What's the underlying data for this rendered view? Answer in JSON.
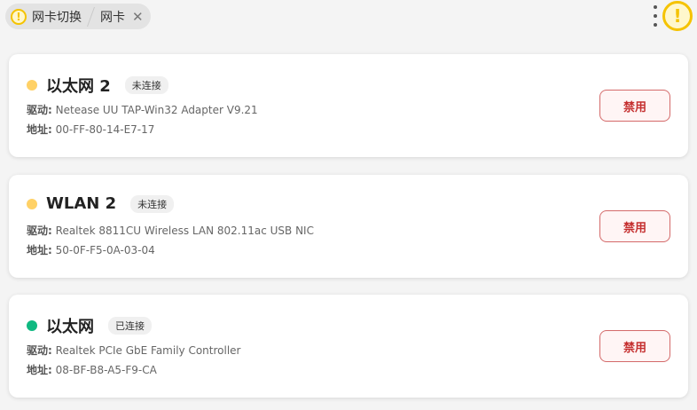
{
  "breadcrumb": {
    "items": [
      {
        "label": "网卡切换"
      },
      {
        "label": "网卡"
      }
    ],
    "close": "✕"
  },
  "header": {
    "warning_glyph": "!"
  },
  "labels": {
    "driver": "驱动:",
    "address": "地址:"
  },
  "colors": {
    "disconnected": "#ffd166",
    "connected": "#10b981",
    "button_text": "#c53030"
  },
  "adapters": [
    {
      "name": "以太网 2",
      "status": "未连接",
      "driver": "Netease UU TAP-Win32 Adapter V9.21",
      "address": "00-FF-80-14-E7-17",
      "button": "禁用"
    },
    {
      "name": "WLAN 2",
      "status": "未连接",
      "driver": "Realtek 8811CU Wireless LAN 802.11ac USB NIC",
      "address": "50-0F-F5-0A-03-04",
      "button": "禁用"
    },
    {
      "name": "以太网",
      "status": "已连接",
      "driver": "Realtek PCIe GbE Family Controller",
      "address": "08-BF-B8-A5-F9-CA",
      "button": "禁用"
    }
  ]
}
